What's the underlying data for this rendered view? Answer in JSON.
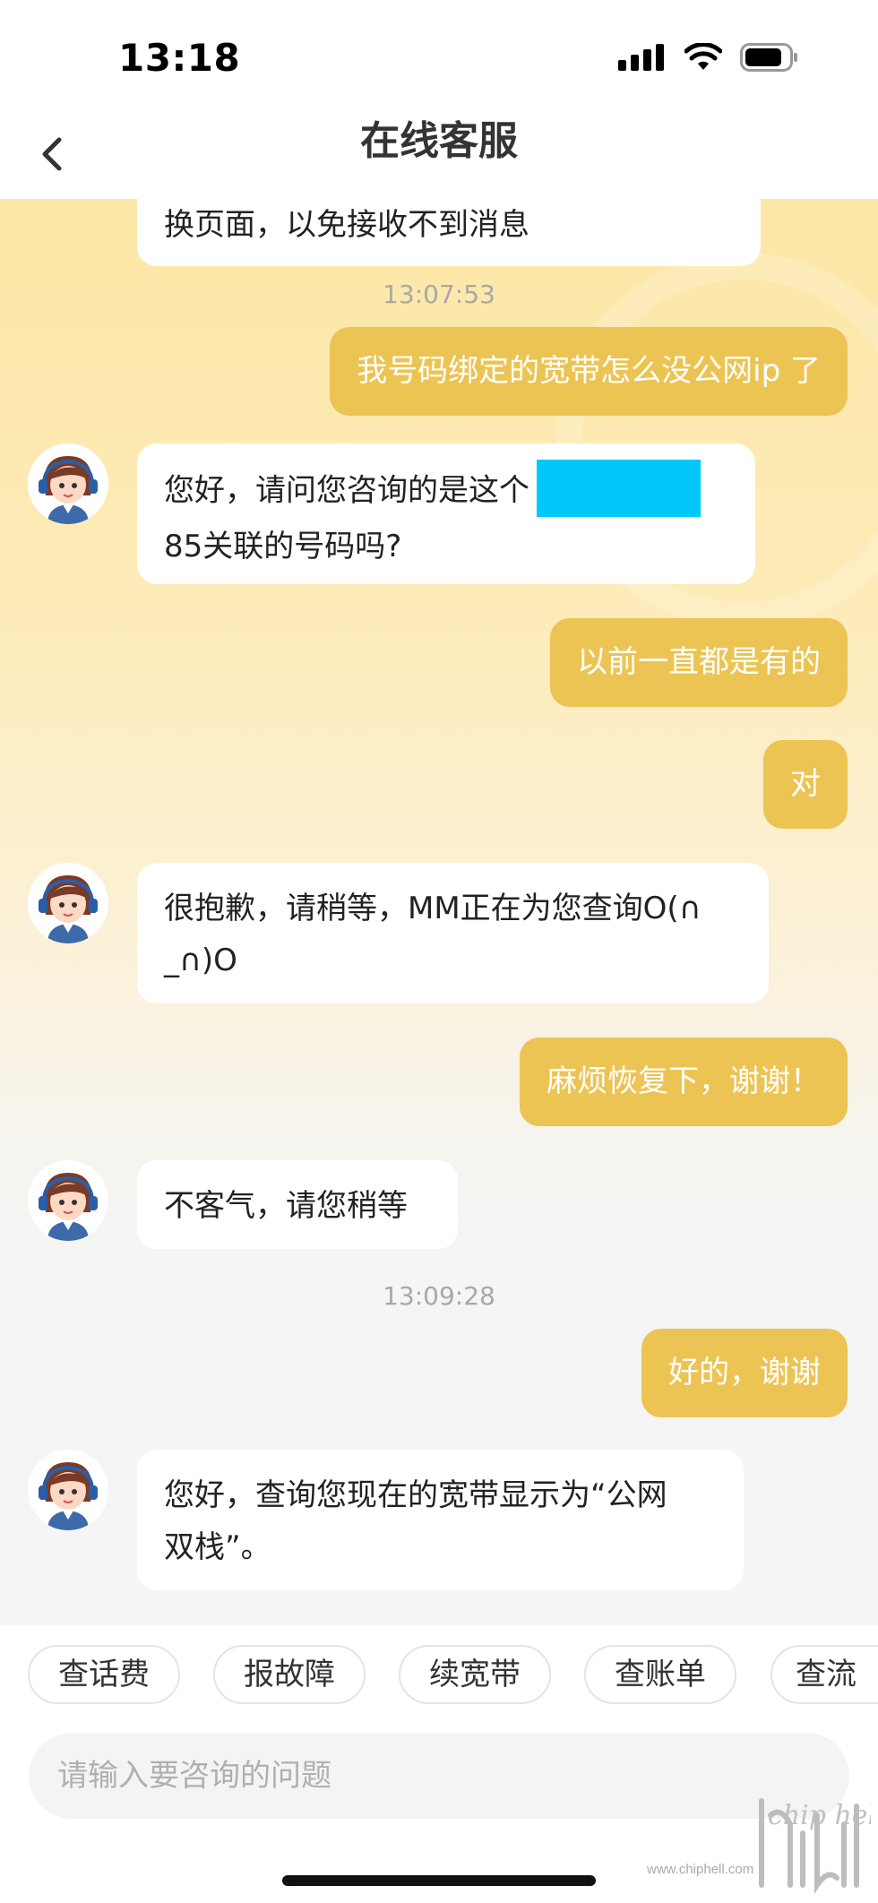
{
  "status_bar": {
    "time": "13:18"
  },
  "nav": {
    "title": "在线客服"
  },
  "messages": [
    {
      "type": "agent",
      "text": "换页面，以免接收不到消息"
    },
    {
      "type": "timestamp",
      "text": "13:07:53"
    },
    {
      "type": "user",
      "text": "我号码绑定的宽带怎么没公网ip 了"
    },
    {
      "type": "agent",
      "line1": "您好，请问您咨询的是这个",
      "line2": "85关联的号码吗?"
    },
    {
      "type": "user",
      "text": "以前一直都是有的"
    },
    {
      "type": "user",
      "text": "对"
    },
    {
      "type": "agent",
      "line1": "很抱歉，请稍等，MM正在为您查询O(∩",
      "line2": "_∩)O"
    },
    {
      "type": "user",
      "text": "麻烦恢复下，谢谢！"
    },
    {
      "type": "agent",
      "text": "不客气，请您稍等"
    },
    {
      "type": "timestamp",
      "text": "13:09:28"
    },
    {
      "type": "user",
      "text": "好的，谢谢"
    },
    {
      "type": "agent",
      "line1": "您好，查询您现在的宽带显示为“公网",
      "line2": "双栈”。"
    }
  ],
  "quick_replies": [
    "查话费",
    "报故障",
    "续宽带",
    "查账单",
    "查流"
  ],
  "input": {
    "placeholder": "请输入要咨询的问题"
  },
  "watermark": {
    "text": "www.chiphell.com",
    "logo": "chip hell"
  },
  "colors": {
    "user_bubble": "#ecc453",
    "agent_bubble": "#ffffff",
    "redaction": "#00c8f8",
    "header_bg": "#ffffff"
  }
}
